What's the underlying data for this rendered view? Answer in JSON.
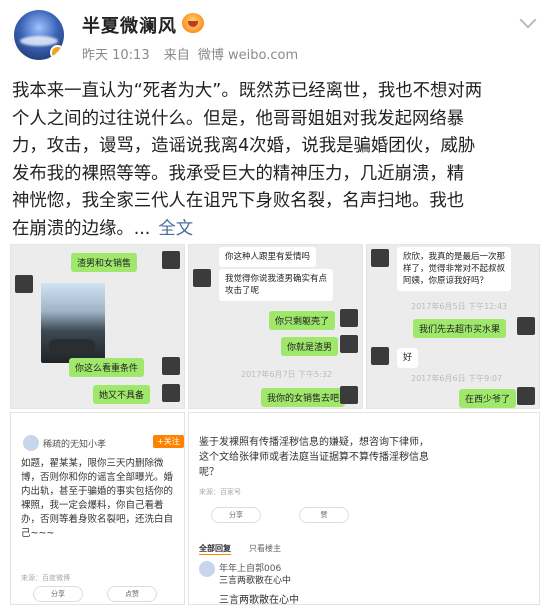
{
  "header": {
    "username": "半夏微澜风",
    "time": "昨天 10:13",
    "source_prefix": "来自",
    "source": "微博 weibo.com"
  },
  "post": {
    "lines": [
      "我本来一直认为“死者为大”。既然苏已经离世，我也不想对两",
      "个人之间的过往说什么。但是，他哥哥姐姐对我发起网络暴",
      "力，攻击，谩骂，造谣说我离4次婚，说我是骗婚团伙，威胁",
      "发布我的裸照等等。我承受巨大的精神压力，几近崩溃，精",
      "神恍惚，我全家三代人在诅咒下身败名裂，名声扫地。我也",
      "在崩溃的边缘。..."
    ],
    "fulltext": "全文"
  },
  "images": {
    "chat1": {
      "b1": "渣男和女销售",
      "b2": "你这么看重条件",
      "b3": "她又不具备"
    },
    "chat2": {
      "b1": "你这种人跟里有爱情吗",
      "b2": "我觉得你说我渣男确实有点\n攻击了呢",
      "b3": "你只剩躯壳了",
      "b4": "你就是渣男",
      "ts": "2017年6月7日 下午5:32",
      "b5": "我你的女销售去吧"
    },
    "chat3": {
      "b1": "欣欣，我真的是最后一次那\n样了，觉得非常对不起叔叔\n阿姨，你原谅我好吗？",
      "ts1": "2017年6月5日 下午12:43",
      "b2": "我们先去超市买水果",
      "b3": "好",
      "ts2": "2017年6月6日 下午9:07",
      "b4": "在西少爷了"
    },
    "web1": {
      "name": "稀疏的无知小孝",
      "follow": "+关注",
      "text": "如题，翟某某，限你三天内删除微博，否则你和你的谣言全部曝光。婚内出轨，甚至于骗婚的事实包括你的裸照，我一定会爆料，你自己看着办，否则等着身败名裂吧，还洗白自己~~~",
      "meta": "来源：百度微博",
      "share": "分享",
      "like": "点赞"
    },
    "web2": {
      "text": "鉴于发裸照有传播淫秽信息的嫌疑，想咨询下律师，这个文给张律师或者法庭当证据算不算传播淫秽信息呢？",
      "meta": "来源：百家号",
      "share": "分享",
      "like": "赞",
      "tab_all": "全部回复",
      "tab_author": "只看楼主",
      "reply_name": "年年上自郭006",
      "reply_text": "三言两歌散在心中",
      "reply_bottom": "三言两歌散在心中"
    }
  }
}
